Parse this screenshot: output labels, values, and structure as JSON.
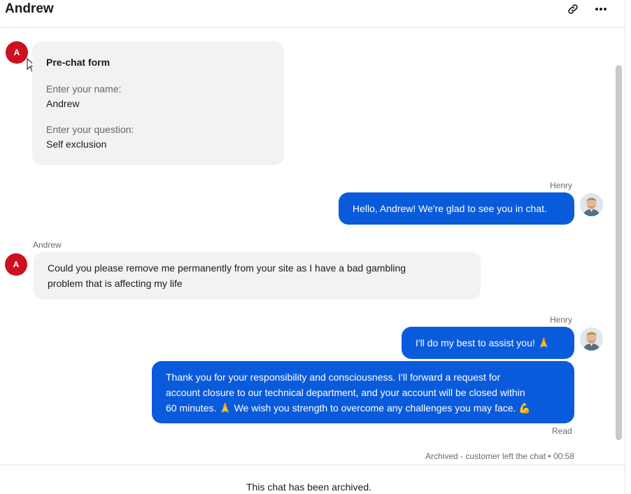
{
  "header": {
    "title": "Andrew",
    "link_icon": "link-icon",
    "more_icon": "more-options-icon"
  },
  "customer_initial": "A",
  "prechat_form": {
    "title": "Pre-chat form",
    "name_label": "Enter your name:",
    "name_value": "Andrew",
    "question_label": "Enter your question:",
    "question_value": "Self exclusion"
  },
  "messages": [
    {
      "sender": "Henry",
      "text": "Hello, Andrew! We're glad to see you in chat."
    },
    {
      "sender": "Andrew",
      "text_line1": "Could you please remove me permanently from your site as I have a bad gambling",
      "text_line2": "problem that is affecting my life"
    },
    {
      "sender": "Henry",
      "text": "I'll do my best to assist you! 🙏"
    },
    {
      "text_line1": "Thank you for your responsibility and consciousness. I'll forward a request for",
      "text_line2": "account closure to our technical department, and your account will be closed within",
      "text_line3": "60 minutes. 🙏 We wish you strength to overcome any challenges you may face. 💪"
    }
  ],
  "read_status": "Read",
  "archive_status": "Archived - customer left the chat • 00:58",
  "footer": "This chat has been archived.",
  "colors": {
    "agent_bubble": "#0a5bdc",
    "customer_bubble": "#f2f2f2",
    "customer_avatar": "#cc1020"
  }
}
